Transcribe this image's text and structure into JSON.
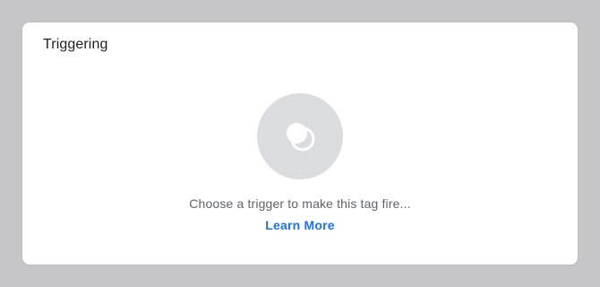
{
  "card": {
    "title": "Triggering",
    "empty_state": {
      "icon": "trigger-rings-icon",
      "message": "Choose a trigger to make this tag fire...",
      "link_label": "Learn More"
    }
  },
  "colors": {
    "page_background": "#c6c6c8",
    "card_background": "#ffffff",
    "icon_circle": "#dadce0",
    "link": "#1a73e8",
    "hint_text": "#5f6368",
    "title_text": "#202124"
  }
}
